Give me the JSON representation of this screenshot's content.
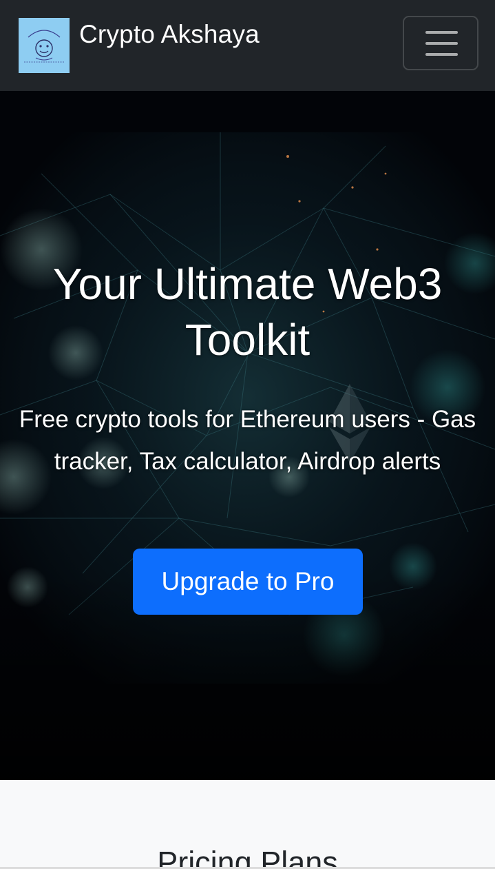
{
  "navbar": {
    "brand_name": "Crypto Akshaya",
    "logo_icon": "cartoon-face-logo",
    "logo_text": "Crypto Akshaya",
    "logo_tagline": "Crypto Akshaya",
    "toggle_icon": "hamburger-menu-icon",
    "background": "#212529"
  },
  "hero": {
    "title": "Your Ultimate Web3 Toolkit",
    "subtitle": "Free crypto tools for Ethereum users - Gas tracker, Tax calculator, Airdrop alerts",
    "cta_label": "Upgrade to Pro",
    "background_icon": "ethereum-network-image",
    "accent_color": "#0d6efd"
  },
  "pricing": {
    "title": "Pricing Plans"
  }
}
